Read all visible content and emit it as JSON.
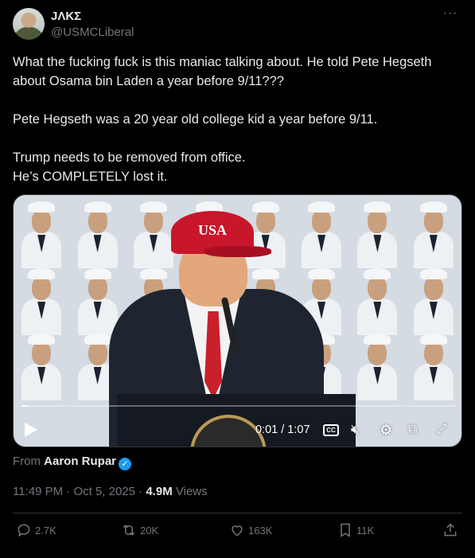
{
  "user": {
    "display_name": "JΛKΣ",
    "handle": "@USMCLiberal"
  },
  "more_glyph": "···",
  "tweet": {
    "paragraphs": [
      "What the fucking fuck is this maniac talking about. He told Pete Hegseth about Osama bin Laden a year before 9/11???",
      "Pete Hegseth was a 20 year old college kid a year before 9/11.",
      "Trump needs to be removed from office."
    ],
    "last_line": "He’s COMPLETELY lost it."
  },
  "media": {
    "hat_text": "USA",
    "time_display": "0:01 / 1:07",
    "cc_label": "CC",
    "progress_fraction": 0.016
  },
  "source": {
    "prefix": "From",
    "author": "Aaron Rupar"
  },
  "meta": {
    "time": "11:49 PM",
    "separator": "·",
    "date": "Oct 5, 2025",
    "views_count": "4.9M",
    "views_label": "Views"
  },
  "actions": {
    "replies": "2.7K",
    "reposts": "20K",
    "likes": "163K",
    "bookmarks": "11K"
  },
  "colors": {
    "accent": "#1d9bf0",
    "muted": "#71767b",
    "text": "#e7e9ea",
    "background": "#000000"
  }
}
